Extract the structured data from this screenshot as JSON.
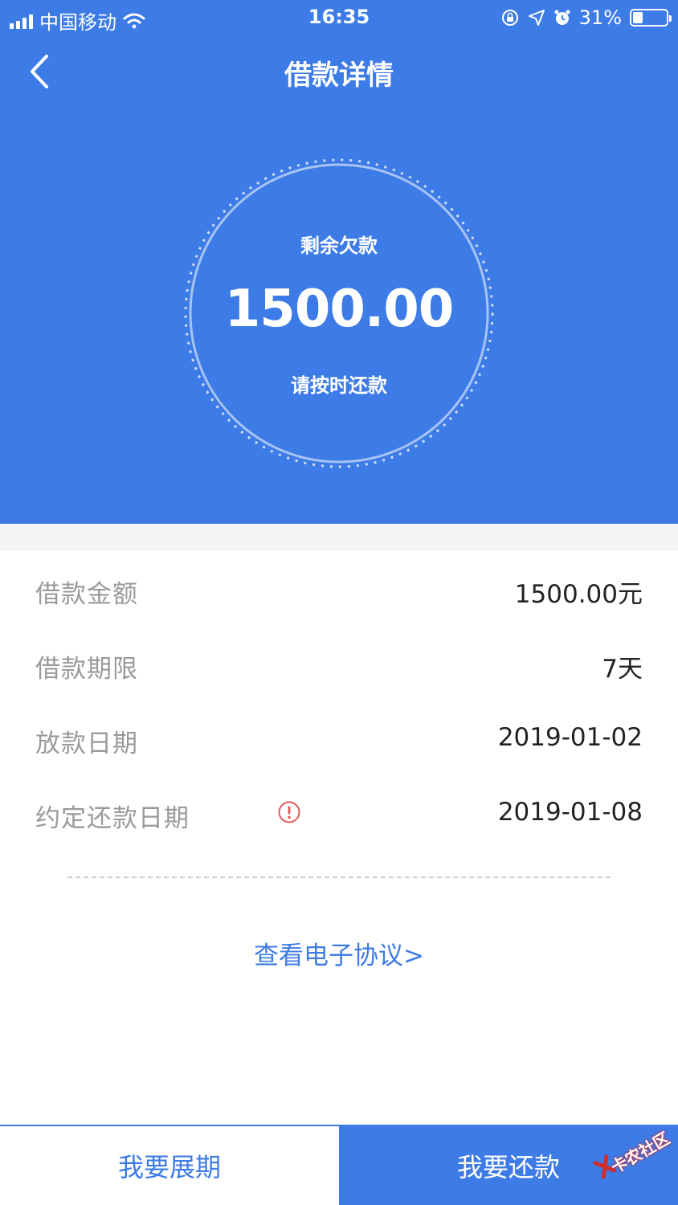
{
  "status_bar": {
    "carrier": "中国移动",
    "time": "16:35",
    "battery_percent": "31%",
    "battery_level": 0.31
  },
  "nav": {
    "title": "借款详情",
    "back_icon": "chevron-left-icon"
  },
  "summary": {
    "label": "剩余欠款",
    "amount": "1500.00",
    "hint": "请按时还款"
  },
  "details": [
    {
      "label": "借款金额",
      "value": "1500.00元"
    },
    {
      "label": "借款期限",
      "value": "7天"
    },
    {
      "label": "放款日期",
      "value": "2019-01-02"
    },
    {
      "label": "约定还款日期",
      "value": "2019-01-08"
    }
  ],
  "agreement_link": "查看电子协议>",
  "buttons": {
    "extend": "我要展期",
    "repay": "我要还款"
  },
  "watermark": "卡农社区",
  "colors": {
    "primary": "#3d7be6",
    "warning": "#e05a5a",
    "label_gray": "#9a9a9a"
  }
}
